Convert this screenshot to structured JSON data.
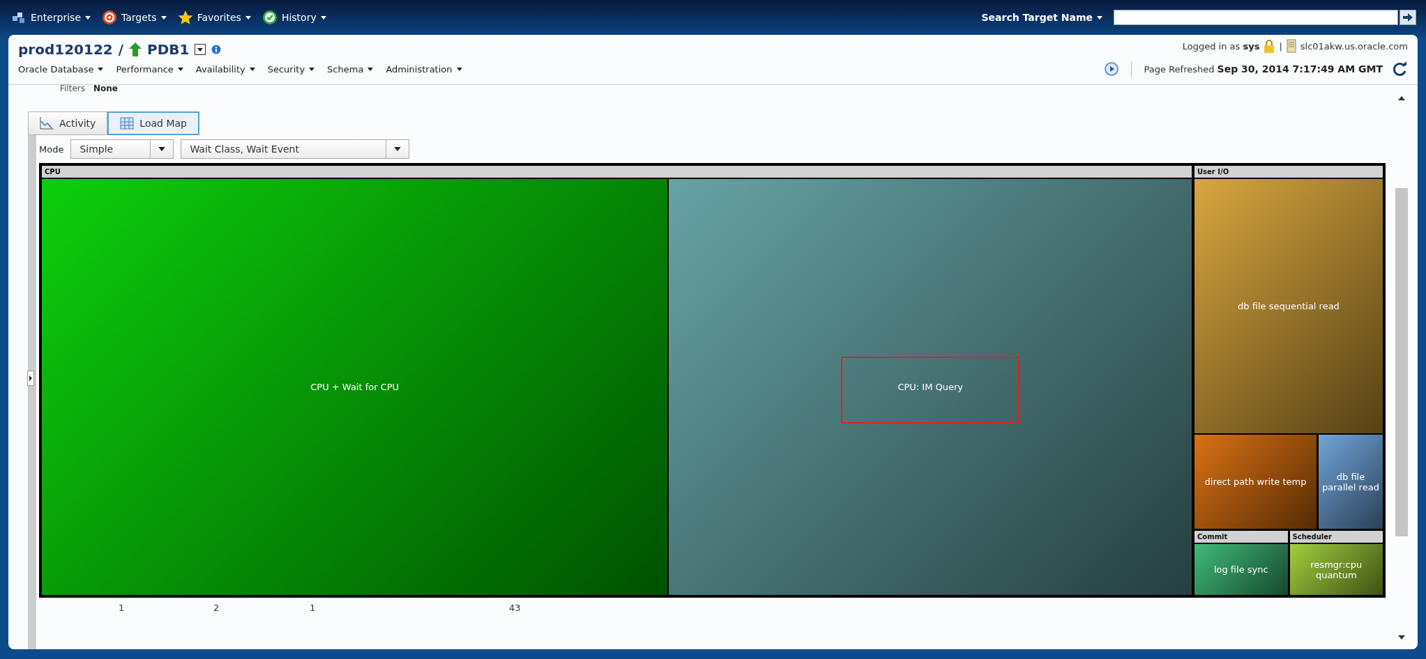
{
  "top_menu": [
    {
      "label": "Enterprise"
    },
    {
      "label": "Targets"
    },
    {
      "label": "Favorites"
    },
    {
      "label": "History"
    }
  ],
  "search": {
    "label": "Search Target Name"
  },
  "target": {
    "parent": "prod120122",
    "separator": "/",
    "name": "PDB1"
  },
  "login": {
    "prefix": "Logged in as",
    "user": "sys",
    "separator": "|",
    "host": "slc01akw.us.oracle.com"
  },
  "nav_menu": [
    "Oracle Database",
    "Performance",
    "Availability",
    "Security",
    "Schema",
    "Administration"
  ],
  "refresh": {
    "label": "Page Refreshed",
    "time": "Sep 30, 2014 7:17:49 AM GMT"
  },
  "filters": {
    "label": "Filters",
    "value": "None"
  },
  "tabs": [
    {
      "label": "Activity",
      "selected": false
    },
    {
      "label": "Load Map",
      "selected": true
    }
  ],
  "mode": {
    "label": "Mode",
    "value": "Simple",
    "dimensions": "Wait Class, Wait Event"
  },
  "treemap": [
    {
      "group": "CPU",
      "tiles": [
        {
          "label": "CPU + Wait for CPU",
          "color": "#00cc00",
          "highlighted": false
        },
        {
          "label": "CPU: IM Query",
          "color": "#5f9ea0",
          "highlighted": true
        }
      ]
    },
    {
      "group": "User I/O",
      "tiles": [
        {
          "label": "db file sequential read",
          "color": "#d6a235",
          "highlighted": false
        },
        {
          "label": "direct path write temp",
          "color": "#d86a08",
          "highlighted": false
        },
        {
          "label": "db file parallel read",
          "color": "#6aa0d8",
          "highlighted": false
        }
      ]
    },
    {
      "group": "Commit",
      "tiles": [
        {
          "label": "log file sync",
          "color": "#36b673",
          "highlighted": false
        }
      ]
    },
    {
      "group": "Scheduler",
      "tiles": [
        {
          "label": "resmgr:cpu quantum",
          "color": "#9ccc33",
          "highlighted": false
        }
      ]
    }
  ],
  "footer_counts": [
    "1",
    "2",
    "1",
    "43"
  ]
}
